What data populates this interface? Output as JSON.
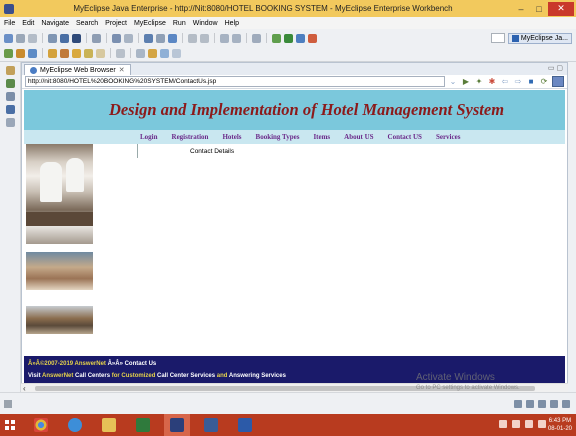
{
  "window": {
    "title": "MyEclipse Java Enterprise - http://Nit:8080/HOTEL BOOKING SYSTEM - MyEclipse Enterprise Workbench",
    "minimize_glyph": "–",
    "maximize_glyph": "□",
    "close_glyph": "✕"
  },
  "menu": [
    "File",
    "Edit",
    "Navigate",
    "Search",
    "Project",
    "MyEclipse",
    "Run",
    "Window",
    "Help"
  ],
  "perspective": {
    "label": "MyEclipse Ja..."
  },
  "browser": {
    "tab_label": "MyEclipse Web Browser",
    "tab_close": "✕",
    "url": "http://nit:8080/HOTEL%20BOOKING%20SYSTEM/ContactUs.jsp",
    "dropdown_glyph": "⌄"
  },
  "site": {
    "banner_title": "Design and Implementation of Hotel Management System",
    "nav": [
      "Login",
      "Registration",
      "Hotels",
      "Booking Types",
      "Items",
      "About US",
      "Contact US",
      "Services"
    ],
    "contact_text": "Contact Details",
    "footer": {
      "line1_highlight": "Â»Â©2007-2019 AnswerNet",
      "line1_rest": " Â»Â» Contact Us",
      "line2_a": "Visit ",
      "line2_b": "AnswerNet",
      "line2_c": " Call Centers ",
      "line2_d": "for Customized",
      "line2_e": " Call Center Services ",
      "line2_f": "and",
      "line2_g": " Answering Services"
    }
  },
  "watermark": {
    "line1": "Activate Windows",
    "line2": "Go to PC settings to activate Windows."
  },
  "clock": {
    "time": "6:43 PM",
    "date": "08-01-20"
  },
  "colors": {
    "banner_bg": "#7bc8dc",
    "banner_text": "#8c1a1a",
    "nav_text": "#6b2a8a",
    "footer_bg": "#1a1a6a",
    "taskbar": "#b83b1f"
  }
}
